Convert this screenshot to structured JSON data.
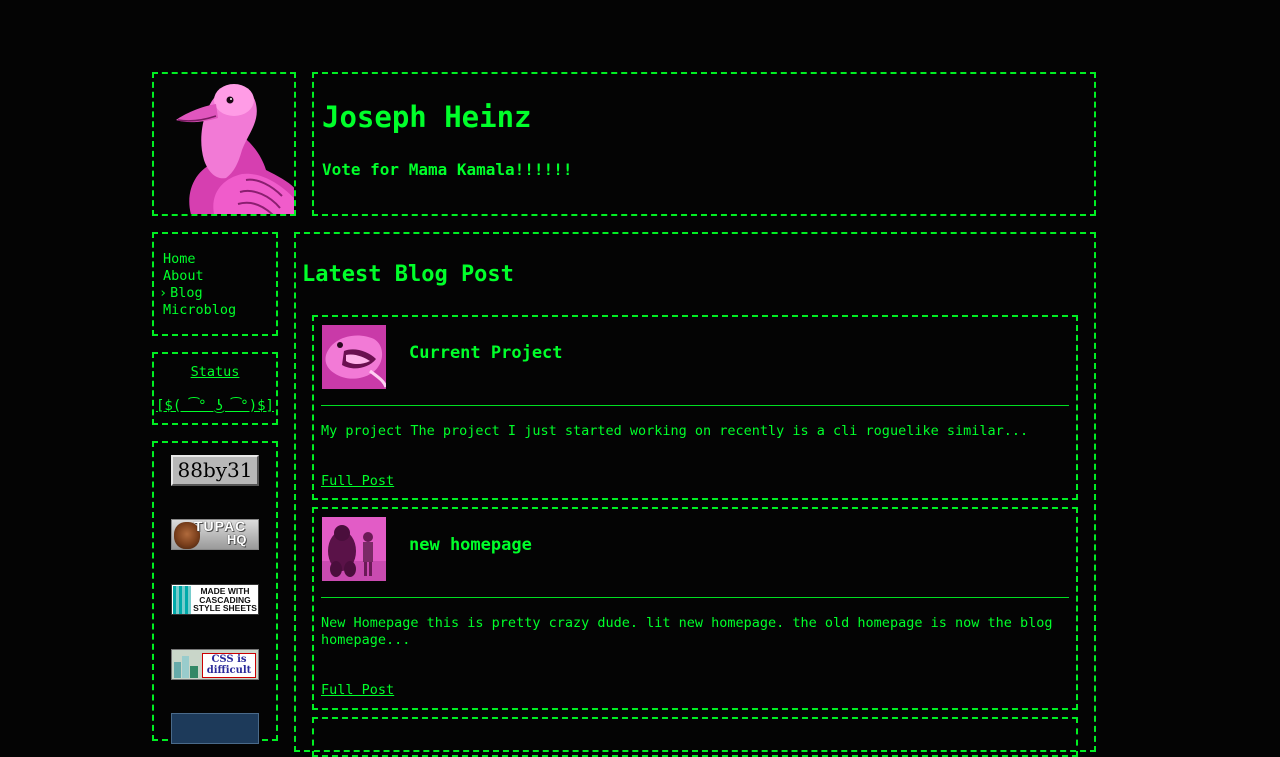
{
  "header": {
    "title": "Joseph Heinz",
    "tagline": "Vote for Mama Kamala!!!!!!"
  },
  "nav": {
    "items": [
      {
        "label": "Home",
        "active": false
      },
      {
        "label": "About",
        "active": false
      },
      {
        "label": "Blog",
        "active": true
      },
      {
        "label": "Microblog",
        "active": false
      }
    ]
  },
  "status": {
    "link_label": "Status",
    "face": "[$( ͡° ͜ʖ ͡°)$]"
  },
  "buttons": {
    "badge_88by31": "88by31",
    "badge_tupac_line1": "TUPAC",
    "badge_tupac_line2": "HQ",
    "badge_css_text": "MADE WITH CASCADING STYLE SHEETS",
    "badge_difficult_text": "CSS is difficult"
  },
  "main": {
    "heading": "Latest Blog Post",
    "posts": [
      {
        "title": "Current Project",
        "excerpt": "My project The project I just started working on recently is a cli roguelike similar...",
        "link_label": "Full Post",
        "thumb_icon": "fish-icon"
      },
      {
        "title": "new homepage",
        "excerpt": "New Homepage this is pretty crazy dude. lit new homepage. the old homepage is now the blog homepage...",
        "link_label": "Full Post",
        "thumb_icon": "gorilla-icon"
      }
    ]
  },
  "colors": {
    "background": "#040404",
    "accent": "#00ff2a",
    "thumb_pink": "#ff4fd8"
  }
}
